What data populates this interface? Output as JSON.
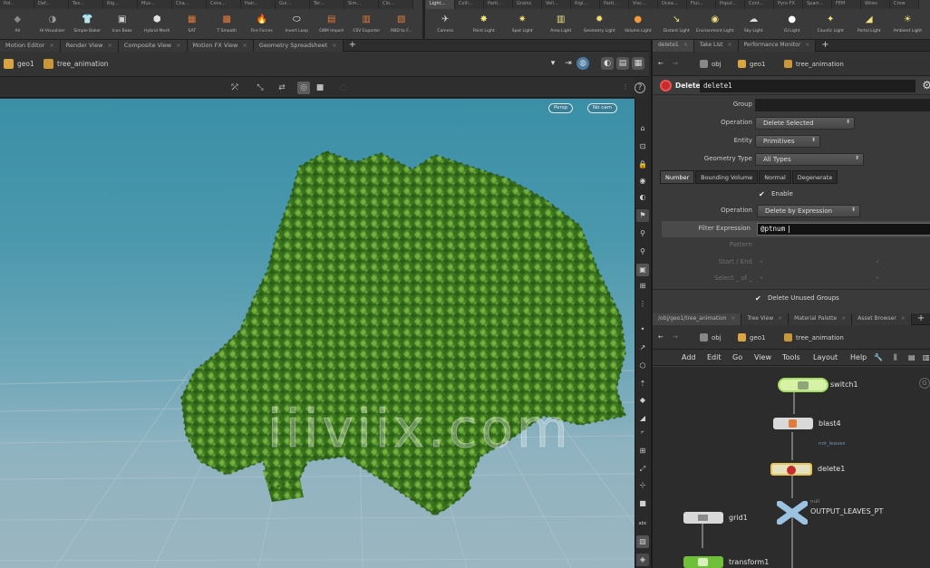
{
  "shelf": {
    "left_tabs": [
      "Pol...",
      "Def...",
      "Tex...",
      "Rig...",
      "Mus...",
      "Cha...",
      "Cons...",
      "Hair...",
      "Gui...",
      "Ter...",
      "Sim...",
      "Clo..."
    ],
    "left_tools": [
      {
        "label": "All",
        "icon": "shelf-tool-icon",
        "color": "#888888",
        "glyph": "◆"
      },
      {
        "label": "Hi-Visualizer",
        "icon": "visualizer-icon",
        "color": "#9a9a9a",
        "glyph": "◑"
      },
      {
        "label": "Simple Baker",
        "icon": "shirt-icon",
        "color": "#d8d8d8",
        "glyph": "👕"
      },
      {
        "label": "Icon Bake",
        "icon": "icon-bake-icon",
        "color": "#cfcfcf",
        "glyph": "▣"
      },
      {
        "label": "Hybrid Mesh",
        "icon": "hybrid-mesh-icon",
        "color": "#e0e0e0",
        "glyph": "⬢"
      },
      {
        "label": "SAT",
        "icon": "sat-icon",
        "color": "#e27a3a",
        "glyph": "▦"
      },
      {
        "label": "T Smooth",
        "icon": "smooth-icon",
        "color": "#e27a3a",
        "glyph": "▩"
      },
      {
        "label": "Fire Forces",
        "icon": "fire-icon",
        "color": "#ffffff",
        "glyph": "🔥"
      },
      {
        "label": "Invert Loop",
        "icon": "loop-icon",
        "color": "#ffffff",
        "glyph": "⬭"
      },
      {
        "label": "OBM Import",
        "icon": "import-icon",
        "color": "#e27a3a",
        "glyph": "▤"
      },
      {
        "label": "CSV Exporter",
        "icon": "export-icon",
        "color": "#e27a3a",
        "glyph": "▥"
      },
      {
        "label": "RBD to F...",
        "icon": "rbd-icon",
        "color": "#e27a3a",
        "glyph": "▧"
      }
    ],
    "right_tabs": [
      "Light...",
      "Colli...",
      "Parti...",
      "Grains",
      "Vell...",
      "Rigi...",
      "Parti...",
      "Visc...",
      "Ocea...",
      "Flui...",
      "Popul...",
      "Cont...",
      "Pyro FX",
      "Sparr...",
      "FEM",
      "Wires",
      "Crow"
    ],
    "right_tools": [
      {
        "label": "Camera",
        "icon": "camera-icon",
        "color": "#d0d0d0",
        "glyph": "✈"
      },
      {
        "label": "Point Light",
        "icon": "point-light-icon",
        "color": "#f3e27a",
        "glyph": "✸"
      },
      {
        "label": "Spot Light",
        "icon": "spot-light-icon",
        "color": "#f3e27a",
        "glyph": "✷"
      },
      {
        "label": "Area Light",
        "icon": "area-light-icon",
        "color": "#f3e27a",
        "glyph": "▥"
      },
      {
        "label": "Geometry Light",
        "icon": "geometry-light-icon",
        "color": "#f3e27a",
        "glyph": "✹"
      },
      {
        "label": "Volume Light",
        "icon": "volume-light-icon",
        "color": "#f39a3a",
        "glyph": "●"
      },
      {
        "label": "Distant Light",
        "icon": "distant-light-icon",
        "color": "#f3e27a",
        "glyph": "↘"
      },
      {
        "label": "Environment Light",
        "icon": "environment-light-icon",
        "color": "#f3e27a",
        "glyph": "◉"
      },
      {
        "label": "Sky Light",
        "icon": "sky-light-icon",
        "color": "#dcdcdc",
        "glyph": "☁"
      },
      {
        "label": "GI Light",
        "icon": "gi-light-icon",
        "color": "#ffffff",
        "glyph": "●"
      },
      {
        "label": "Caustic Light",
        "icon": "caustic-light-icon",
        "color": "#f3e27a",
        "glyph": "✦"
      },
      {
        "label": "Portal Light",
        "icon": "portal-light-icon",
        "color": "#f3e27a",
        "glyph": "◢"
      },
      {
        "label": "Ambient Light",
        "icon": "ambient-light-icon",
        "color": "#f3e27a",
        "glyph": "☀"
      }
    ]
  },
  "left_pane": {
    "tabs": [
      "Motion Editor",
      "Render View",
      "Composite View",
      "Motion FX View",
      "Geometry Spreadsheet"
    ],
    "path": {
      "obj": "geo1",
      "node": "tree_animation"
    },
    "viewport": {
      "persp_label": "Persp",
      "cam_label": "No cam",
      "watermark": "iiiviix.com"
    }
  },
  "right_pane": {
    "param_tabs": [
      "delete1",
      "Take List",
      "Performance Monitor"
    ],
    "path": {
      "root": "obj",
      "obj": "geo1",
      "node": "tree_animation"
    },
    "node": {
      "type": "Delete",
      "name": "delete1"
    },
    "params": {
      "group_label": "Group",
      "operation_label": "Operation",
      "operation_value": "Delete Selected",
      "entity_label": "Entity",
      "entity_value": "Primitives",
      "geometry_type_label": "Geometry Type",
      "geometry_type_value": "All Types",
      "subtabs": [
        "Number",
        "Bounding Volume",
        "Normal",
        "Degenerate"
      ],
      "enable_label": "Enable",
      "number_operation_label": "Operation",
      "number_operation_value": "Delete by Expression",
      "filter_expression_label": "Filter Expression",
      "filter_expression_value": "@ptnum",
      "pattern_label": "Pattern",
      "start_end_label": "Start / End",
      "select_of_label": "Select _ of _",
      "delete_unused_groups_label": "Delete Unused Groups"
    },
    "net_tabs": [
      "/obj/geo1/tree_animation",
      "Tree View",
      "Material Palette",
      "Asset Browser"
    ],
    "net_path": {
      "root": "obj",
      "obj": "geo1",
      "node": "tree_animation"
    },
    "net_menu": [
      "Add",
      "Edit",
      "Go",
      "View",
      "Tools",
      "Layout",
      "Help"
    ],
    "nodes": {
      "switch1": "switch1",
      "blast4": "blast4",
      "blast4_sub": "not_leaves",
      "delete1": "delete1",
      "output": "OUTPUT_LEAVES_PT",
      "output_sub": "null",
      "grid1": "grid1",
      "transform1": "transform1"
    }
  }
}
